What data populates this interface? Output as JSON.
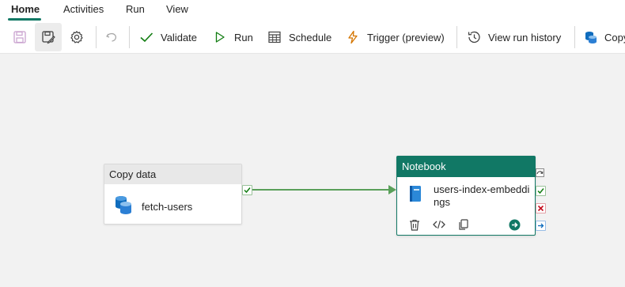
{
  "tabs": [
    {
      "label": "Home",
      "active": true
    },
    {
      "label": "Activities",
      "active": false
    },
    {
      "label": "Run",
      "active": false
    },
    {
      "label": "View",
      "active": false
    }
  ],
  "toolbar": {
    "icons": [
      "save-icon",
      "save-as-icon",
      "gear-icon",
      "undo-icon"
    ],
    "validate": "Validate",
    "run": "Run",
    "schedule": "Schedule",
    "trigger": "Trigger (preview)",
    "view_run_history": "View run history",
    "copy": "Copy"
  },
  "canvas": {
    "activities": [
      {
        "type_label": "Copy data",
        "name": "fetch-users",
        "icon": "copy-data-icon"
      },
      {
        "type_label": "Notebook",
        "name": "users-index-embeddings",
        "icon": "notebook-icon"
      }
    ],
    "connection": {
      "from": "fetch-users",
      "to": "users-index-embeddings",
      "condition": "On success"
    }
  },
  "colors": {
    "accent": "#117865",
    "success": "#107c10",
    "failure": "#c50f1f",
    "completion": "#0f6cbd",
    "edge": "#5aa05a"
  }
}
